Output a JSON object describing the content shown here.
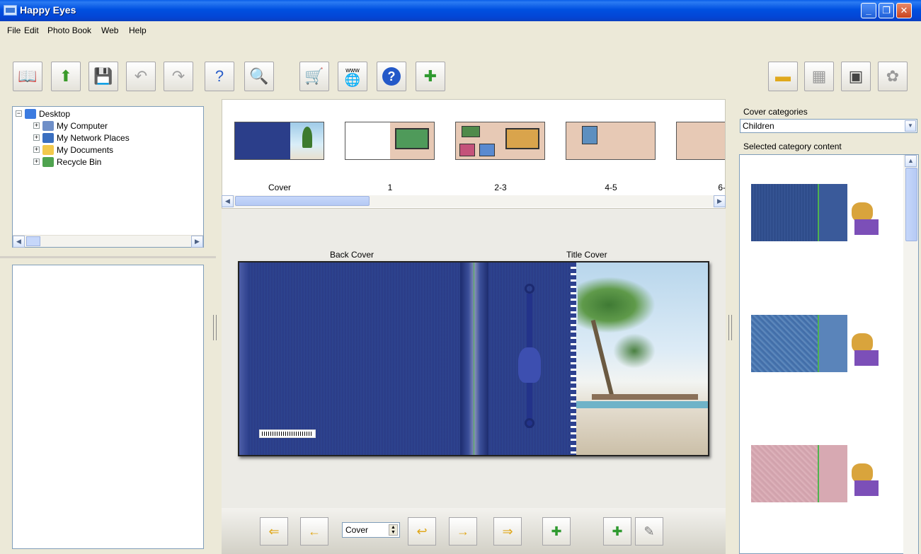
{
  "window": {
    "title": "Happy Eyes"
  },
  "menu": {
    "file": "File",
    "edit": "Edit",
    "photobook": "Photo Book",
    "web": "Web",
    "help": "Help"
  },
  "toolbar": {
    "web_label": "www"
  },
  "tree": {
    "items": [
      {
        "label": "Desktop",
        "icon": "desktop-icon",
        "expander": "−"
      },
      {
        "label": "My Computer",
        "icon": "computer-icon",
        "expander": "+"
      },
      {
        "label": "My Network Places",
        "icon": "network-icon",
        "expander": "+"
      },
      {
        "label": "My Documents",
        "icon": "folder-icon",
        "expander": "+"
      },
      {
        "label": "Recycle Bin",
        "icon": "recycle-bin-icon",
        "expander": "+"
      }
    ]
  },
  "thumbnails": {
    "labels": [
      "Cover",
      "1",
      "2-3",
      "4-5",
      "6-"
    ]
  },
  "editor": {
    "left_page_title": "Back Cover",
    "right_page_title": "Title Cover"
  },
  "navigation": {
    "page_value": "Cover"
  },
  "right_panel": {
    "categories_label": "Cover categories",
    "selected_category": "Children",
    "content_label": "Selected category content"
  },
  "colors": {
    "titlebar": "#0050e0",
    "cover_blue": "#2b3e8a",
    "window_bg": "#ece9d8"
  }
}
